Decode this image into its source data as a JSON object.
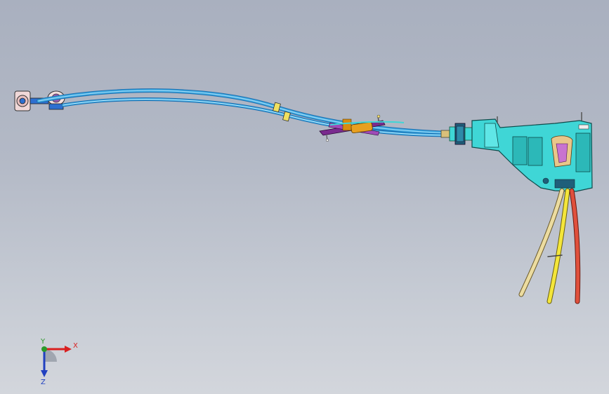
{
  "viewport": {
    "background_top": "#a9b0bf",
    "background_bottom": "#d3d6dc"
  },
  "model": {
    "cable_color": "#3aa8e0",
    "cable_highlight": "#9fd8f6",
    "bracket_color": "#3fd6d6",
    "purple_part": "#7a2b8f",
    "orange_part": "#e8a020",
    "wire_colors": [
      "#ecdca0",
      "#f4e63a",
      "#e0503c"
    ]
  },
  "triad": {
    "x_label": "X",
    "y_label": "Y",
    "z_label": "Z",
    "x_color": "#d92020",
    "y_color": "#2a9a2a",
    "z_color": "#2040c0"
  }
}
